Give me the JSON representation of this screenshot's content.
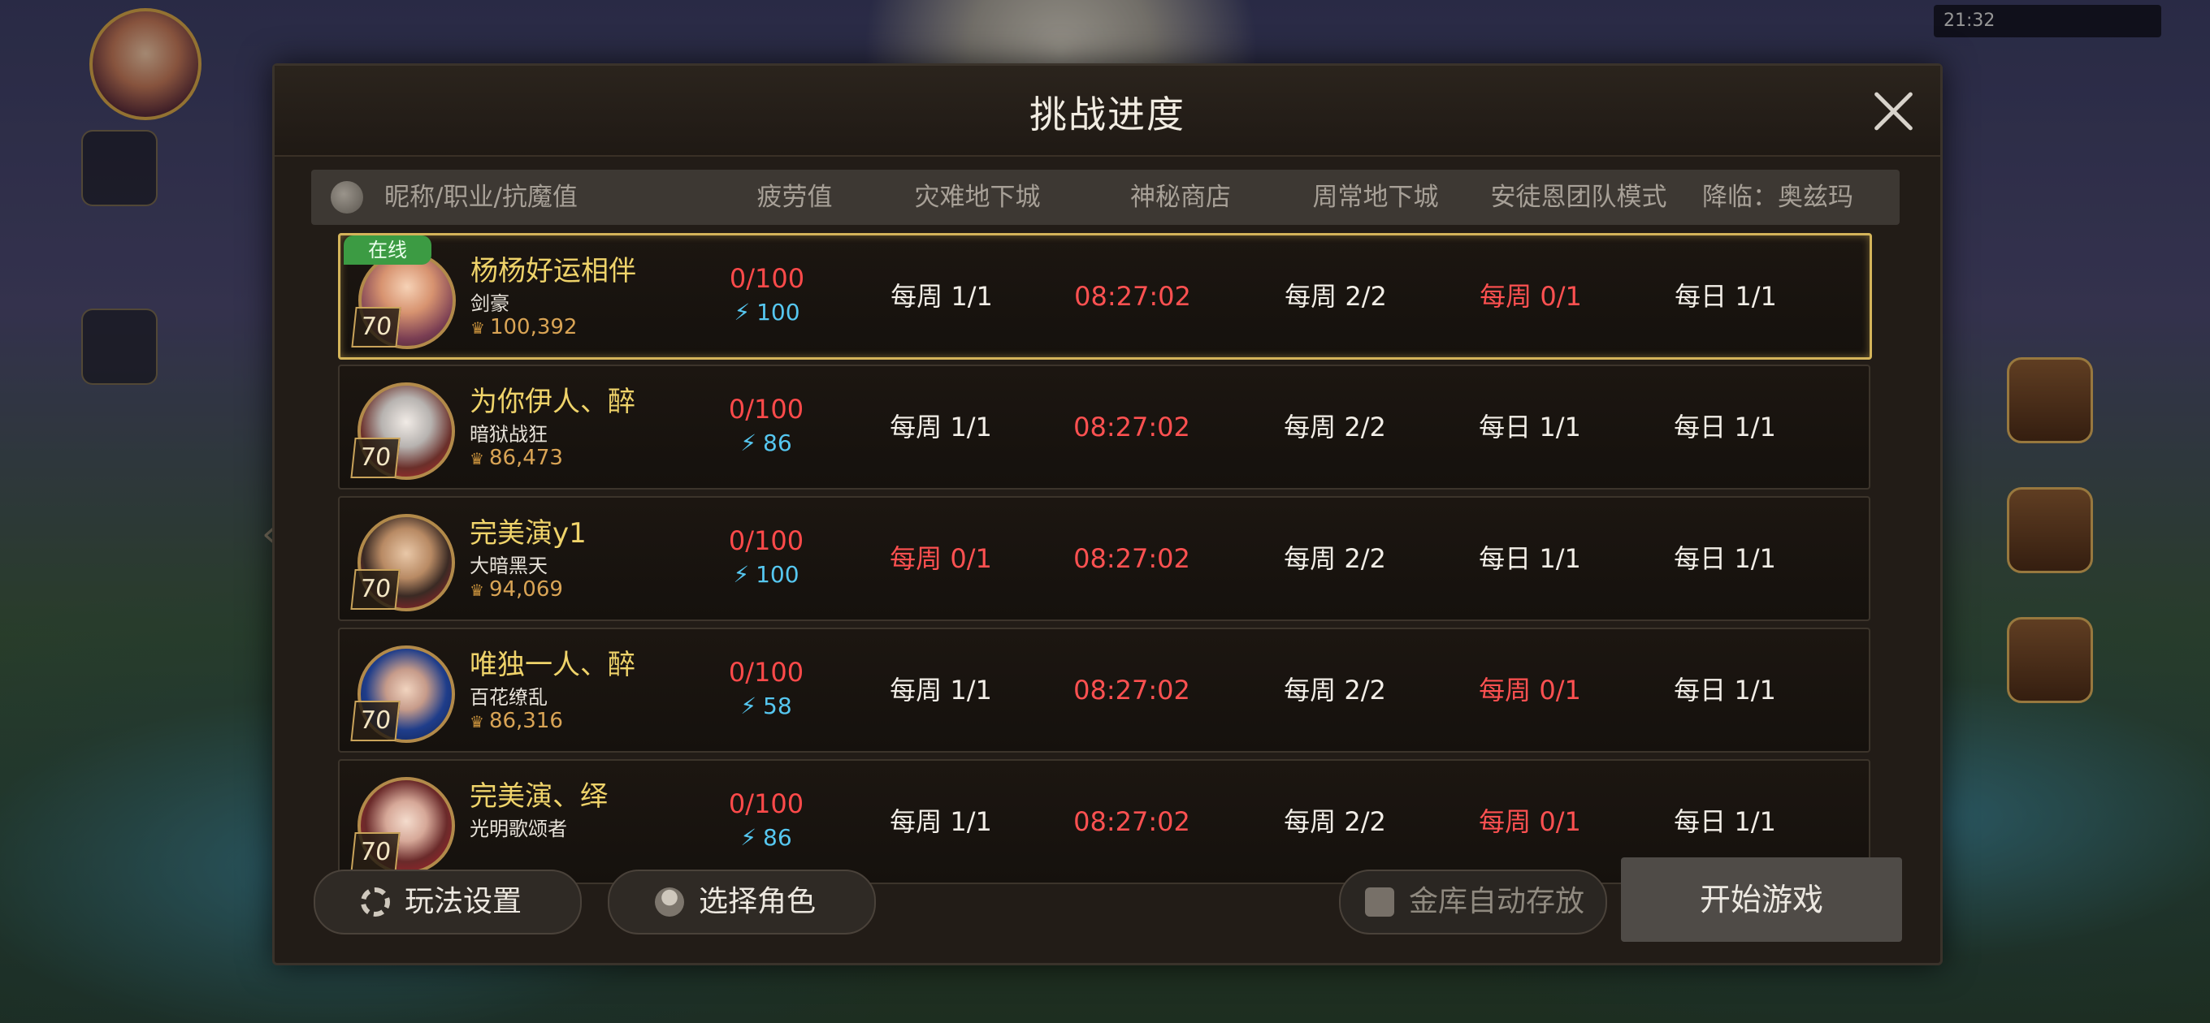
{
  "status_bar": {
    "time": "21:32"
  },
  "dialog": {
    "title": "挑战进度",
    "columns": {
      "character": "昵称/职业/抗魔值",
      "fatigue": "疲劳值",
      "disaster_dungeon": "灾难地下城",
      "mystic_shop": "神秘商店",
      "weekly_dungeon": "周常地下城",
      "antoine_raid": "安徒恩团队模式",
      "ozma": "降临：奥兹玛"
    },
    "rows": [
      {
        "online": "在线",
        "level": "70",
        "name": "杨杨好运相伴",
        "job": "剑豪",
        "power": "100,392",
        "fatigue": "0/100",
        "energy": "100",
        "disaster": "每周 1/1",
        "shop": "08:27:02",
        "weekly": "每周 2/2",
        "antoine": "每周 0/1",
        "ozma": "每日 1/1",
        "disaster_red": false,
        "antoine_red": true,
        "active": true
      },
      {
        "online": "",
        "level": "70",
        "name": "为你伊人、醉",
        "job": "暗狱战狂",
        "power": "86,473",
        "fatigue": "0/100",
        "energy": "86",
        "disaster": "每周 1/1",
        "shop": "08:27:02",
        "weekly": "每周 2/2",
        "antoine": "每日 1/1",
        "ozma": "每日 1/1",
        "disaster_red": false,
        "antoine_red": false,
        "active": false
      },
      {
        "online": "",
        "level": "70",
        "name": "完美演y1",
        "job": "大暗黑天",
        "power": "94,069",
        "fatigue": "0/100",
        "energy": "100",
        "disaster": "每周 0/1",
        "shop": "08:27:02",
        "weekly": "每周 2/2",
        "antoine": "每日 1/1",
        "ozma": "每日 1/1",
        "disaster_red": true,
        "antoine_red": false,
        "active": false
      },
      {
        "online": "",
        "level": "70",
        "name": "唯独一人、醉",
        "job": "百花缭乱",
        "power": "86,316",
        "fatigue": "0/100",
        "energy": "58",
        "disaster": "每周 1/1",
        "shop": "08:27:02",
        "weekly": "每周 2/2",
        "antoine": "每周 0/1",
        "ozma": "每日 1/1",
        "disaster_red": false,
        "antoine_red": true,
        "active": false
      },
      {
        "online": "",
        "level": "70",
        "name": "完美演、绎",
        "job": "光明歌颂者",
        "power": "",
        "fatigue": "0/100",
        "energy": "86",
        "disaster": "每周 1/1",
        "shop": "08:27:02",
        "weekly": "每周 2/2",
        "antoine": "每周 0/1",
        "ozma": "每日 1/1",
        "disaster_red": false,
        "antoine_red": true,
        "active": false
      }
    ],
    "footer": {
      "settings": "玩法设置",
      "select_role": "选择角色",
      "vault_auto": "金库自动存放",
      "start": "开始游戏"
    }
  },
  "colors": {
    "accent_gold": "#efd36a",
    "alert_red": "#ff5151",
    "energy_blue": "#56c7f0",
    "online_green": "#3c9b43"
  }
}
